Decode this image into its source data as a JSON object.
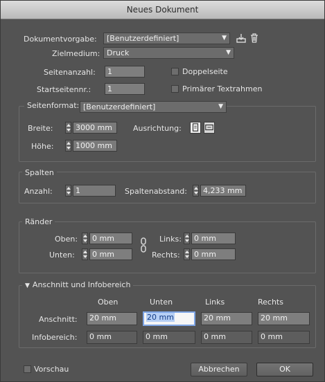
{
  "title": "Neues Dokument",
  "dokumentvorgabe": {
    "label": "Dokumentvorgabe:",
    "value": "[Benutzerdefiniert]"
  },
  "zielmedium": {
    "label": "Zielmedium:",
    "value": "Druck"
  },
  "seitenanzahl": {
    "label": "Seitenanzahl:",
    "value": "1"
  },
  "startseitennr": {
    "label": "Startseitennr.:",
    "value": "1"
  },
  "doppelseite": {
    "label": "Doppelseite",
    "checked": false
  },
  "primaerer_textrahmen": {
    "label": "Primärer Textrahmen",
    "checked": false
  },
  "seitenformat": {
    "label": "Seitenformat:",
    "value": "[Benutzerdefiniert]",
    "breite_label": "Breite:",
    "breite": "3000 mm",
    "hoehe_label": "Höhe:",
    "hoehe": "1000 mm",
    "ausrichtung_label": "Ausrichtung:"
  },
  "spalten": {
    "title": "Spalten",
    "anzahl_label": "Anzahl:",
    "anzahl": "1",
    "abstand_label": "Spaltenabstand:",
    "abstand": "4,233 mm"
  },
  "raender": {
    "title": "Ränder",
    "oben_label": "Oben:",
    "oben": "0 mm",
    "unten_label": "Unten:",
    "unten": "0 mm",
    "links_label": "Links:",
    "links": "0 mm",
    "rechts_label": "Rechts:",
    "rechts": "0 mm"
  },
  "anschnitt": {
    "title": "Anschnitt und Infobereich",
    "columns": [
      "Oben",
      "Unten",
      "Links",
      "Rechts"
    ],
    "anschnitt_label": "Anschnitt:",
    "anschnitt_values": [
      "20 mm",
      "20 mm",
      "20 mm",
      "20 mm"
    ],
    "infobereich_label": "Infobereich:",
    "infobereich_values": [
      "0 mm",
      "0 mm",
      "0 mm",
      "0 mm"
    ]
  },
  "vorschau": {
    "label": "Vorschau",
    "checked": false
  },
  "buttons": {
    "cancel": "Abbrechen",
    "ok": "OK"
  }
}
